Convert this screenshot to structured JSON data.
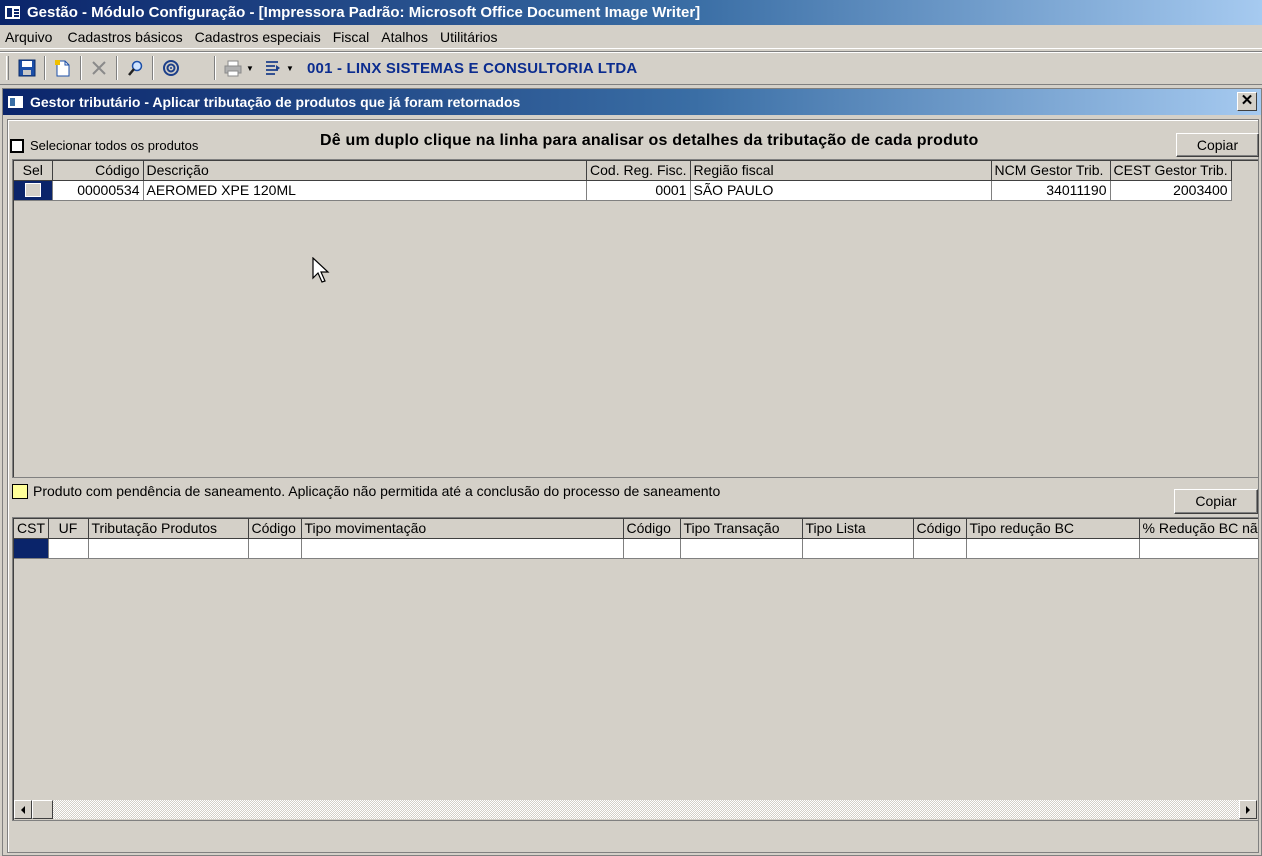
{
  "window": {
    "title": "Gestão  - Módulo Configuração - [Impressora Padrão: Microsoft Office Document Image Writer]"
  },
  "menu": {
    "items": [
      "Arquivo",
      "Cadastros básicos",
      "Cadastros especiais",
      "Fiscal",
      "Atalhos",
      "Utilitários"
    ]
  },
  "toolbar": {
    "company": "001 - LINX SISTEMAS E CONSULTORIA LTDA",
    "icons": [
      "save-icon",
      "new-document-icon",
      "delete-icon",
      "search-icon",
      "target-icon",
      "print-icon",
      "export-icon"
    ]
  },
  "child": {
    "title": "Gestor tributário - Aplicar tributação de produtos que já foram retornados",
    "close": "✕",
    "select_all_label": "Selecionar todos os produtos",
    "instruction": "Dê um duplo clique na linha para analisar os detalhes da tributação de cada produto",
    "copy_top": "Copiar",
    "copy_bottom": "Copiar",
    "legend": "Produto com pendência de saneamento. Aplicação não permitida até a conclusão do processo de saneamento",
    "legend_color": "#ffff99"
  },
  "grid1": {
    "headers": {
      "sel": "Sel",
      "codigo": "Código",
      "descricao": "Descrição",
      "cod_reg": "Cod. Reg. Fisc.",
      "regiao": "Região fiscal",
      "ncm": "NCM Gestor Trib.",
      "cest": "CEST Gestor Trib."
    },
    "rows": [
      {
        "codigo": "00000534",
        "descricao": "AEROMED XPE 120ML",
        "cod_reg": "0001",
        "regiao": "SÃO PAULO",
        "ncm": "34011190",
        "cest": "2003400"
      }
    ]
  },
  "grid2": {
    "headers": {
      "cst": "CST",
      "uf": "UF",
      "trib": "Tributação Produtos",
      "cod1": "Código",
      "tipo_mov": "Tipo movimentação",
      "cod2": "Código",
      "tipo_trans": "Tipo Transação",
      "tipo_lista": "Tipo Lista",
      "cod3": "Código",
      "tipo_red": "Tipo redução BC",
      "pct_red": "% Redução BC não"
    }
  },
  "colors": {
    "title_start": "#0a246a",
    "title_end": "#a6caf0",
    "company_text": "#0b2c8f",
    "selection": "#0a246a"
  }
}
